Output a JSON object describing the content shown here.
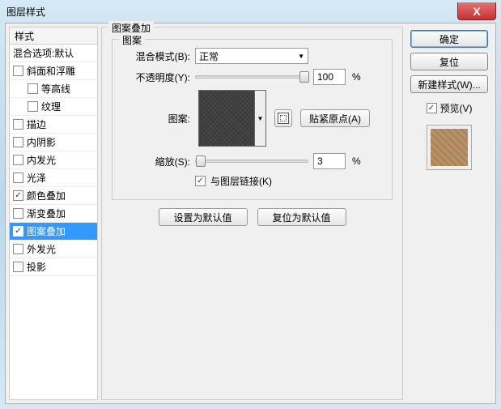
{
  "window": {
    "title": "图层样式",
    "close": "X"
  },
  "left": {
    "header": "样式",
    "items": [
      {
        "label": "混合选项:默认",
        "noCheckbox": true
      },
      {
        "label": "斜面和浮雕",
        "checked": false
      },
      {
        "label": "等高线",
        "checked": false,
        "indent": true
      },
      {
        "label": "纹理",
        "checked": false,
        "indent": true
      },
      {
        "label": "描边",
        "checked": false
      },
      {
        "label": "内阴影",
        "checked": false
      },
      {
        "label": "内发光",
        "checked": false
      },
      {
        "label": "光泽",
        "checked": false
      },
      {
        "label": "颜色叠加",
        "checked": true
      },
      {
        "label": "渐变叠加",
        "checked": false
      },
      {
        "label": "图案叠加",
        "checked": true,
        "selected": true
      },
      {
        "label": "外发光",
        "checked": false
      },
      {
        "label": "投影",
        "checked": false
      }
    ]
  },
  "center": {
    "outerLegend": "图案叠加",
    "innerLegend": "图案",
    "blendMode": {
      "label": "混合模式(B):",
      "value": "正常"
    },
    "opacity": {
      "label": "不透明度(Y):",
      "value": "100",
      "pct": "%"
    },
    "patternLabel": "图案:",
    "snapBtn": "贴紧原点(A)",
    "scale": {
      "label": "缩放(S):",
      "value": "3",
      "pct": "%"
    },
    "linkLayer": {
      "label": "与图层链接(K)",
      "checked": true
    },
    "defaultBtn": "设置为默认值",
    "resetBtn": "复位为默认值"
  },
  "right": {
    "ok": "确定",
    "cancel": "复位",
    "newStyle": "新建样式(W)...",
    "preview": {
      "label": "预览(V)",
      "checked": true
    }
  }
}
